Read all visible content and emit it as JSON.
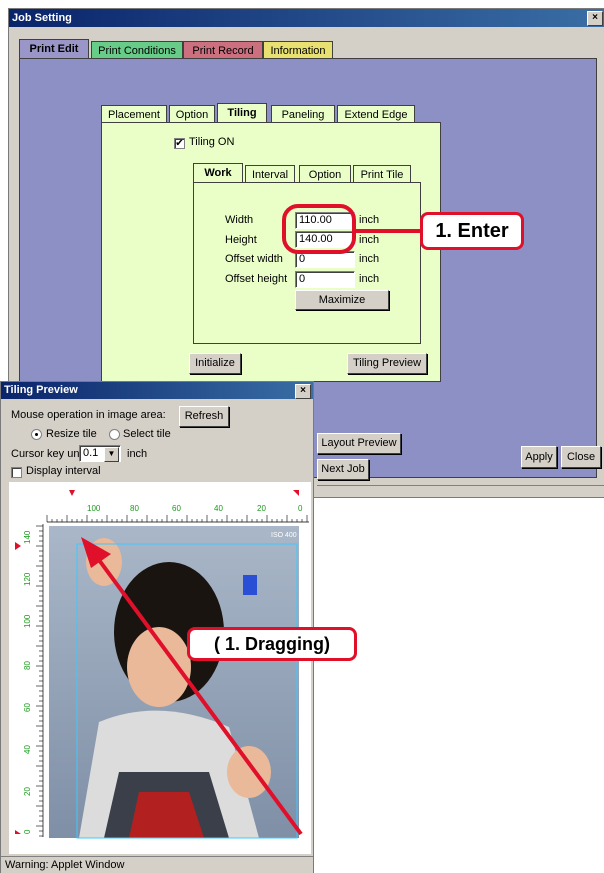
{
  "job_window": {
    "title": "Job Setting",
    "close_glyph": "×",
    "tabs": [
      "Print Edit",
      "Print Conditions",
      "Print Record",
      "Information"
    ],
    "sub_tabs": [
      "Placement",
      "Option",
      "Tiling",
      "Paneling",
      "Extend Edge"
    ],
    "tiling_on_label": "Tiling ON",
    "inner_tabs": [
      "Work",
      "Interval",
      "Option",
      "Print Tile"
    ],
    "fields": {
      "width_label": "Width",
      "width_value": "110.00",
      "height_label": "Height",
      "height_value": "140.00",
      "offset_width_label": "Offset width",
      "offset_width_value": "0",
      "offset_height_label": "Offset height",
      "offset_height_value": "0",
      "unit": "inch"
    },
    "maximize_label": "Maximize",
    "initialize_label": "Initialize",
    "tiling_preview_label": "Tiling Preview",
    "layout_preview_label": "Layout Preview",
    "next_job_label": "Next Job",
    "apply_label": "Apply",
    "close_label": "Close",
    "colors": {
      "tab_print_edit": "#9a96c8",
      "tab_print_conditions": "#66cc88",
      "tab_print_record": "#cc7080",
      "tab_information": "#e8e070",
      "panel": "#8c90c4",
      "tiling_panel": "#eaffc8"
    }
  },
  "preview_window": {
    "title": "Tiling Preview",
    "close_glyph": "×",
    "mouse_label": "Mouse operation in image area:",
    "refresh_label": "Refresh",
    "resize_tile_label": "Resize tile",
    "select_tile_label": "Select tile",
    "cursor_key_label": "Cursor key unit",
    "cursor_key_value": "0.1",
    "cursor_unit": "inch",
    "display_interval_label": "Display interval",
    "ruler_top_labels": [
      "100",
      "80",
      "60",
      "40",
      "20",
      "0"
    ],
    "ruler_left_labels": [
      "140",
      "120",
      "100",
      "80",
      "60",
      "40",
      "20",
      "0"
    ],
    "image_label": "ISO 400",
    "warning": "Warning: Applet Window"
  },
  "annotations": {
    "enter_label": "1. Enter",
    "dragging_label": "( 1. Dragging)",
    "accent_color": "#e0102a"
  }
}
